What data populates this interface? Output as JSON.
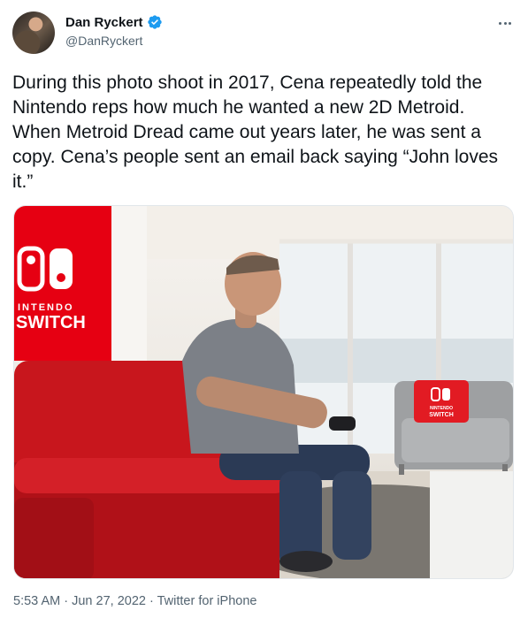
{
  "author": {
    "display_name": "Dan Ryckert",
    "handle": "@DanRyckert",
    "verified_icon": "verified-badge-icon",
    "avatar_icon": "profile-avatar"
  },
  "tweet": {
    "text": "During this photo shoot in 2017, Cena repeatedly told the Nintendo reps how much he wanted a new 2D Metroid. When Metroid Dread came out years later, he was sent a copy. Cena’s people sent an email back saying “John loves it.”",
    "media": {
      "banner_brand_top": "INTENDO",
      "banner_brand_bottom": "SWITCH",
      "pillow_brand_top": "NINTENDO",
      "pillow_brand_bottom": "SWITCH"
    }
  },
  "footer": {
    "time": "5:53 AM",
    "separator": "·",
    "date": "Jun 27, 2022",
    "source": "Twitter for iPhone"
  },
  "colors": {
    "accent": "#1d9bf0",
    "text_primary": "#0f1419",
    "text_secondary": "#536471",
    "nintendo_red": "#e60012",
    "couch_red": "#c8161d"
  }
}
